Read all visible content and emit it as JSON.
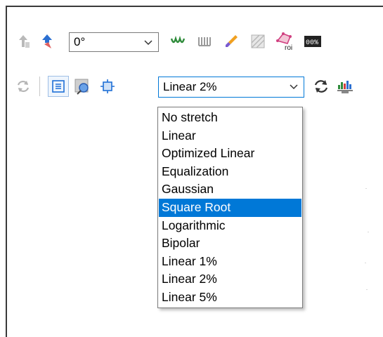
{
  "toolbar_top": {
    "rotation_value": "0°",
    "icons": [
      "align-up-icon",
      "flip-icon",
      "wave-icon",
      "comb-icon",
      "brush-icon",
      "pattern-icon",
      "roi-icon",
      "counter-icon"
    ],
    "roi_label": "roi",
    "counter_label": "00%"
  },
  "toolbar_bottom": {
    "stretch_value": "Linear 2%",
    "icons": [
      "refresh-icon",
      "fit-icon",
      "zoom-icon",
      "center-icon",
      "sync-icon",
      "histogram-icon"
    ]
  },
  "stretch_menu": {
    "options": [
      "No stretch",
      "Linear",
      "Optimized Linear",
      "Equalization",
      "Gaussian",
      "Square Root",
      "Logarithmic",
      "Bipolar",
      "Linear 1%",
      "Linear 2%",
      "Linear 5%"
    ],
    "selected_index": 5
  },
  "colors": {
    "selection": "#0078d7",
    "accent_blue": "#2b6fd1"
  }
}
